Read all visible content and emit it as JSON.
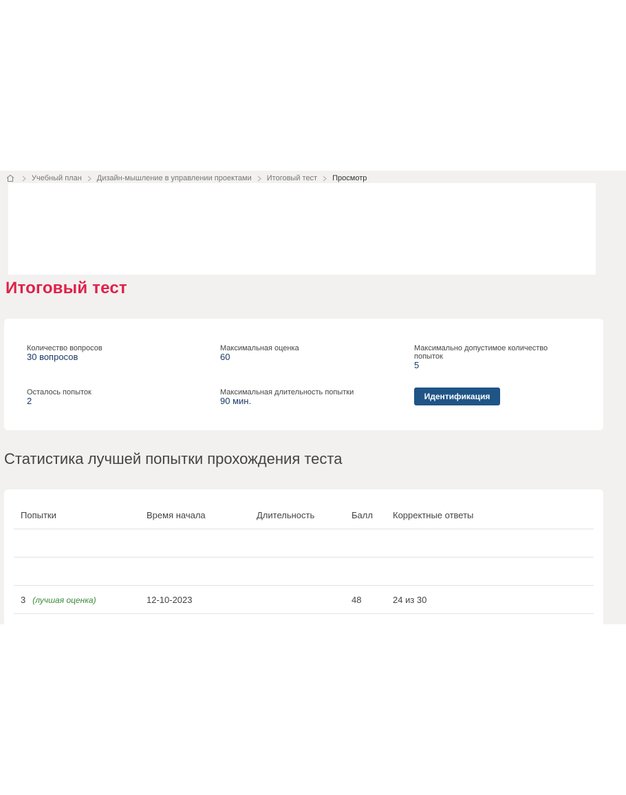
{
  "breadcrumb": {
    "items": [
      "Учебный план",
      "Дизайн-мышление в управлении проектами",
      "Итоговый тест"
    ],
    "current": "Просмотр"
  },
  "page_title": "Итоговый тест",
  "info": {
    "questions_label": "Количество вопросов",
    "questions_value": "30 вопросов",
    "max_score_label": "Максимальная оценка",
    "max_score_value": "60",
    "max_attempts_label": "Максимально допустимое количество попыток",
    "max_attempts_value": "5",
    "remaining_label": "Осталось попыток",
    "remaining_value": "2",
    "max_duration_label": "Максимальная длительность попытки",
    "max_duration_value": "90 мин.",
    "identify_button": "Идентификация"
  },
  "stats": {
    "title": "Статистика лучшей попытки прохождения теста",
    "columns": [
      "Попытки",
      "Время начала",
      "Длительность",
      "Балл",
      "Корректные ответы"
    ],
    "rows": [
      {
        "attempt": "",
        "best": "",
        "start": "",
        "duration": "",
        "score": "",
        "correct": ""
      },
      {
        "attempt": "",
        "best": "",
        "start": "",
        "duration": "",
        "score": "",
        "correct": ""
      },
      {
        "attempt": "3",
        "best": "(лучшая оценка)",
        "start": "12-10-2023",
        "duration": "",
        "score": "48",
        "correct": "24 из 30"
      }
    ]
  },
  "colors": {
    "title_red": "#e0204a",
    "button_blue": "#1f5586",
    "best_green": "#3a8a3a",
    "background": "#f2f1ef"
  }
}
